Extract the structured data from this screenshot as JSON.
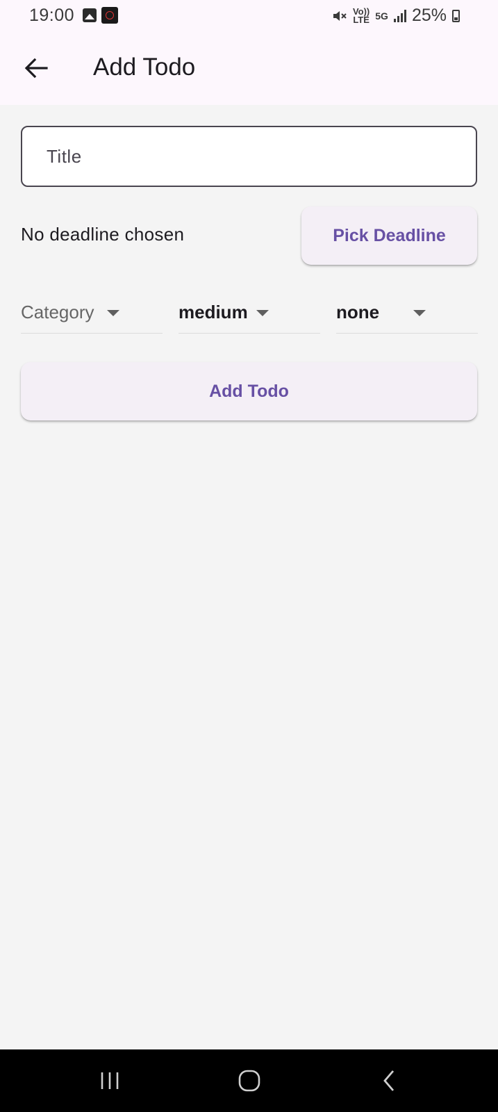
{
  "status_bar": {
    "time": "19:00",
    "volte_label": "Vo))\nLTE",
    "network_label": "5G",
    "battery_percent": "25%"
  },
  "app_bar": {
    "title": "Add Todo"
  },
  "form": {
    "title_placeholder": "Title",
    "deadline_text": "No deadline chosen",
    "pick_deadline_label": "Pick Deadline",
    "category_hint": "Category",
    "priority_value": "medium",
    "repeat_value": "none",
    "add_todo_label": "Add Todo"
  },
  "colors": {
    "accent": "#6750a4",
    "button_bg": "#f4eff6",
    "app_bar_bg": "#fdf7fd",
    "page_bg": "#f4f4f4"
  }
}
